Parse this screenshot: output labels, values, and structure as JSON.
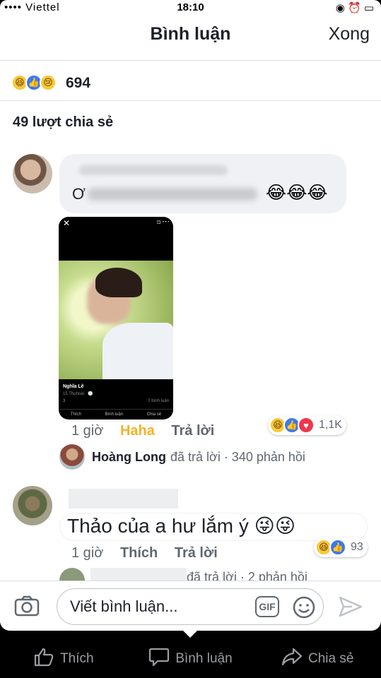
{
  "status": {
    "carrier": "•••• Viettel",
    "time": "18:10",
    "right": "◉ ⏰ ▭"
  },
  "header": {
    "title": "Bình luận",
    "done": "Xong"
  },
  "post": {
    "reaction_count": "694",
    "shares": "49 lượt chia sẻ"
  },
  "comment1": {
    "text_prefix": "Ơ",
    "emoji": "😂😂😂",
    "attachment": {
      "name": "Nghĩa Lê",
      "meta": "15 Thuhoài · 🕒",
      "reactions": "3",
      "comments": "2 bình luận",
      "actions": [
        "Thích",
        "Bình luận",
        "Chia sẻ"
      ]
    },
    "time": "1 giờ",
    "reaction_label": "Haha",
    "reply_label": "Trả lời",
    "reaction_total": "1,1K",
    "reply_preview": {
      "name": "Hoàng Long",
      "text": "đã trả lời · 340 phản hồi"
    }
  },
  "comment2": {
    "text": "Thảo của a hư lắm ý 😜😜",
    "time": "1 giờ",
    "like_label": "Thích",
    "reply_label": "Trả lời",
    "reaction_total": "93",
    "reply_preview": {
      "text": "đã trả lời · 2 phản hồi"
    }
  },
  "composer": {
    "placeholder": "Viết bình luận...",
    "gif": "GIF"
  },
  "tabs": [
    {
      "label": "Thích",
      "icon": "thumbs-up-icon"
    },
    {
      "label": "Bình luận",
      "icon": "comment-icon"
    },
    {
      "label": "Chia sẻ",
      "icon": "share-icon"
    }
  ],
  "colors": {
    "haha": "#f7b125",
    "like_blue": "#3b78f1",
    "love": "#f0364d"
  }
}
